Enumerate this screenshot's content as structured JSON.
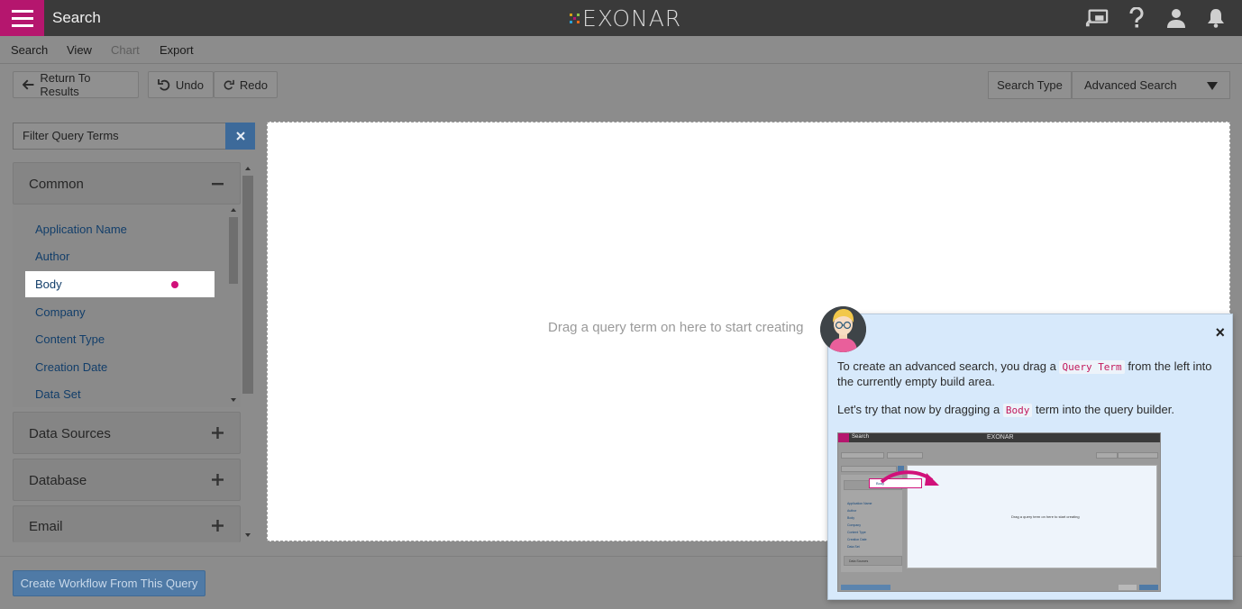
{
  "header": {
    "title": "Search",
    "logo_text": "EXONAR"
  },
  "menu": {
    "items": [
      {
        "label": "Search",
        "enabled": true
      },
      {
        "label": "View",
        "enabled": true
      },
      {
        "label": "Chart",
        "enabled": false
      },
      {
        "label": "Export",
        "enabled": true
      }
    ]
  },
  "toolbar": {
    "return_label": "Return To Results",
    "undo_label": "Undo",
    "redo_label": "Redo",
    "search_type_label": "Search Type",
    "search_type_value": "Advanced Search"
  },
  "left_panel": {
    "filter_placeholder": "Filter Query Terms",
    "sections": [
      {
        "title": "Common",
        "expanded": true
      },
      {
        "title": "Data Sources",
        "expanded": false
      },
      {
        "title": "Database",
        "expanded": false
      },
      {
        "title": "Email",
        "expanded": false
      }
    ],
    "common_terms": [
      "Application Name",
      "Author",
      "Body",
      "Company",
      "Content Type",
      "Creation Date",
      "Data Set"
    ],
    "selected_term": "Body"
  },
  "canvas": {
    "hint": "Drag a query term on here to start creating"
  },
  "footer": {
    "workflow_button": "Create Workflow From This Query"
  },
  "tutorial": {
    "text1_before": "To create an advanced search, you drag a",
    "text1_code": "Query Term",
    "text1_after": "from the left into the currently empty build area.",
    "text2_before": "Let's try that now by dragging a",
    "text2_code": "Body",
    "text2_after": "term into the query builder.",
    "close_symbol": "×"
  },
  "colors": {
    "accent_magenta": "#b5166e",
    "topbar": "#3a3a3a",
    "link_blue": "#123e6a",
    "button_blue": "#4f7aa6",
    "popup_bg": "#d7e9fb"
  }
}
